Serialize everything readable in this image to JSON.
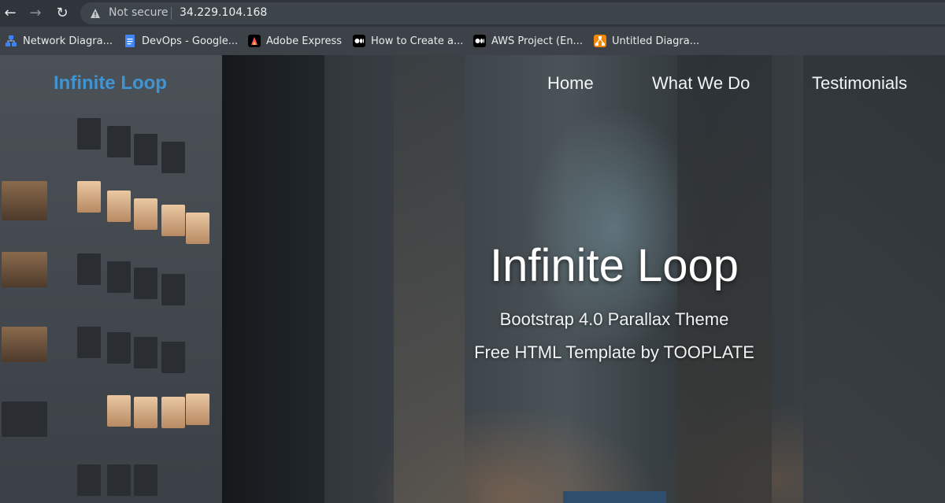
{
  "browser": {
    "security_label": "Not secure",
    "url": "34.229.104.168",
    "bookmarks": [
      {
        "label": "Network Diagra...",
        "icon": "diagram-icon"
      },
      {
        "label": "DevOps - Google...",
        "icon": "google-docs-icon"
      },
      {
        "label": "Adobe Express",
        "icon": "adobe-express-icon"
      },
      {
        "label": "How to Create a...",
        "icon": "medium-icon"
      },
      {
        "label": "AWS Project (En...",
        "icon": "medium-icon"
      },
      {
        "label": "Untitled Diagra...",
        "icon": "drawio-icon"
      }
    ]
  },
  "site": {
    "brand": "Infinite Loop",
    "nav": {
      "home": "Home",
      "what_we_do": "What We Do",
      "testimonials": "Testimonials"
    },
    "hero": {
      "title": "Infinite Loop",
      "subtitle": "Bootstrap 4.0 Parallax Theme",
      "tagline": "Free HTML Template by TOOPLATE"
    }
  },
  "colors": {
    "brand": "#3f95d4",
    "cta": "#2f4d6c"
  }
}
